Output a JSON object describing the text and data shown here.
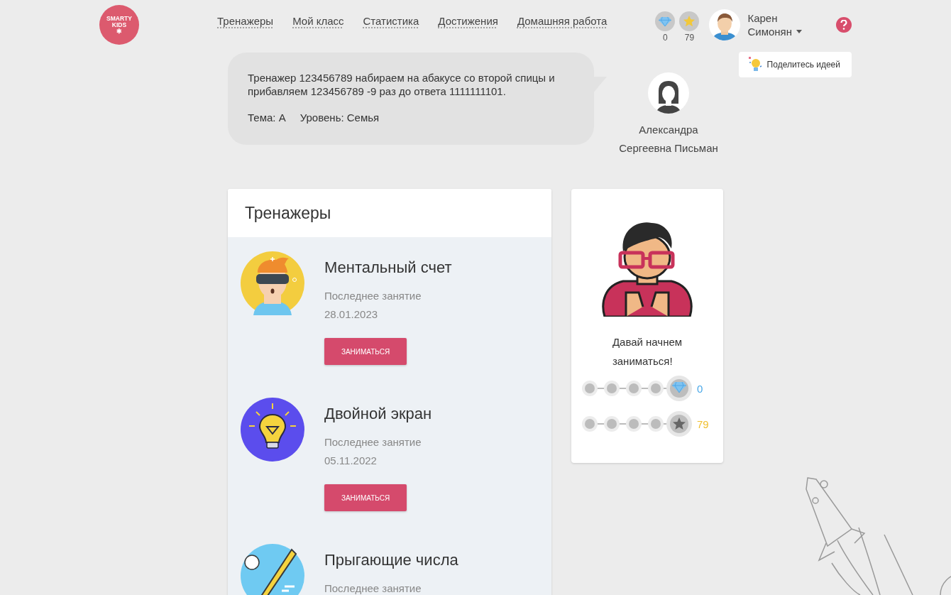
{
  "logo": {
    "line_1": "SMARTY",
    "line_2": "KIDS",
    "mark": "✱"
  },
  "nav": [
    {
      "label": "Тренажеры"
    },
    {
      "label": "Мой класс"
    },
    {
      "label": "Статистика"
    },
    {
      "label": "Достижения"
    },
    {
      "label": "Домашняя работа"
    }
  ],
  "header_counters": [
    {
      "kind": "diamond",
      "count": "0"
    },
    {
      "kind": "star",
      "count": "79"
    }
  ],
  "user": {
    "first_name": "Карен",
    "last_name": "Симонян"
  },
  "idea_button": "Поделитесь идеей",
  "task_bubble": {
    "text": "Тренажер 123456789 набираем на абакусе со второй спицы и прибавляем 123456789 -9 раз до ответа 1111111101.",
    "topic": "Тема: А",
    "level_label": "Уровень: Семья"
  },
  "teacher": {
    "line_1": "Александра",
    "line_2": "Сергеевна Письман"
  },
  "trainers": {
    "title": "Тренажеры",
    "items": [
      {
        "kind": "vr",
        "name": "Ментальный счет",
        "last_label": "Последнее занятие",
        "date": "28.01.2023",
        "button": "ЗАНИМАТЬСЯ"
      },
      {
        "kind": "bulb",
        "name": "Двойной экран",
        "last_label": "Последнее занятие",
        "date": "05.11.2022",
        "button": "ЗАНИМАТЬСЯ"
      },
      {
        "kind": "bat",
        "name": "Прыгающие числа",
        "last_label": "Последнее занятие"
      }
    ]
  },
  "progress_card": {
    "message_line_1": "Давай начнем",
    "message_line_2": "заниматься!",
    "rows": [
      {
        "kind": "diamond",
        "count": "0",
        "color": "#4aa8e8"
      },
      {
        "kind": "star",
        "count": "79",
        "color": "#f0c030"
      }
    ]
  }
}
